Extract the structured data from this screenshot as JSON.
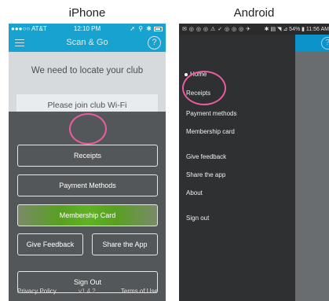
{
  "captions": {
    "iphone": "iPhone",
    "android": "Android"
  },
  "iphone": {
    "status": {
      "carrier": "●●●○○ AT&T",
      "time": "12:10 PM",
      "right_icons": "➚ ⚲ ✱"
    },
    "nav": {
      "title": "Scan & Go",
      "help_glyph": "?"
    },
    "heading": "We need to locate your club",
    "card_text": "Please join club Wi-Fi",
    "buttons": {
      "receipts": "Receipts",
      "payment": "Payment Methods",
      "membership": "Membership Card",
      "feedback": "Give Feedback",
      "share": "Share the App",
      "signout": "Sign Out"
    },
    "footer": {
      "privacy": "Privacy Policy",
      "version": "v1.4.2",
      "terms": "Terms of Use"
    }
  },
  "android": {
    "status": {
      "left_icons": "✉ ◎ ◎ ◎ ⚠ ✓ ◎ ◎ ◎ ✈",
      "right": "✱ ▤ ◥ ⊿ 54% ▮ 11:56 AM"
    },
    "appbar": {
      "help_glyph": "?"
    },
    "drawer": {
      "items": [
        "Home",
        "Receipts",
        "Payment methods",
        "Membership card",
        "Give feedback",
        "Share the app",
        "About",
        "Sign out"
      ]
    }
  },
  "colors": {
    "ios_accent": "#17a2d0",
    "android_accent": "#0c93c9",
    "highlight": "#ea5ca0",
    "membership_green": "#5fb323"
  }
}
